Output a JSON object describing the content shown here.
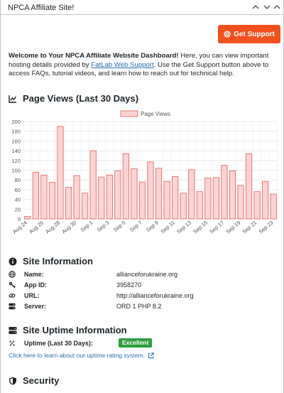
{
  "panel": {
    "title": "NPCA Affiliate Site!"
  },
  "support_button": {
    "label": "Get Support"
  },
  "intro": {
    "bold": "Welcome to Your NPCA Affiliate Website Dashboard!",
    "text1": " Here, you can view important hosting details provided by ",
    "link": "FatLab Web Support",
    "text2": ". Use the Get Support button above to access FAQs, tutorial videos, and learn how to reach out for technical help."
  },
  "page_views": {
    "heading": "Page Views (Last 30 Days)"
  },
  "chart_data": {
    "type": "bar",
    "x": [
      "Aug 24",
      "Aug 25",
      "Aug 26",
      "Aug 27",
      "Aug 28",
      "Aug 29",
      "Aug 30",
      "Aug 31",
      "Sep 1",
      "Sep 2",
      "Sep 3",
      "Sep 4",
      "Sep 5",
      "Sep 6",
      "Sep 7",
      "Sep 8",
      "Sep 9",
      "Sep 10",
      "Sep 11",
      "Sep 12",
      "Sep 13",
      "Sep 14",
      "Sep 15",
      "Sep 16",
      "Sep 17",
      "Sep 18",
      "Sep 19",
      "Sep 20",
      "Sep 21",
      "Sep 22",
      "Sep 23"
    ],
    "tick_labels": [
      "Aug 24",
      "Aug 26",
      "Aug 28",
      "Aug 30",
      "Sep 1",
      "Sep 3",
      "Sep 5",
      "Sep 7",
      "Sep 9",
      "Sep 11",
      "Sep 13",
      "Sep 15",
      "Sep 17",
      "Sep 19",
      "Sep 21",
      "Sep 23"
    ],
    "series": [
      {
        "name": "Page Views",
        "values": [
          5,
          96,
          90,
          75,
          190,
          65,
          89,
          53,
          140,
          86,
          90,
          99,
          134,
          103,
          76,
          117,
          104,
          77,
          87,
          53,
          101,
          56,
          84,
          85,
          110,
          99,
          69,
          134,
          56,
          77,
          51
        ]
      }
    ],
    "ylim": [
      0,
      200
    ],
    "yticks": [
      0,
      20,
      40,
      60,
      80,
      100,
      120,
      140,
      160,
      180,
      200
    ],
    "legend": "top",
    "grid": true,
    "colors": {
      "fill": "#fdd3d3",
      "stroke": "#e06060"
    }
  },
  "site_info": {
    "heading": "Site Information",
    "rows": [
      {
        "icon": "globe-icon",
        "label": "Name:",
        "value": "allianceforukraine.org"
      },
      {
        "icon": "key-icon",
        "label": "App ID:",
        "value": "3958270"
      },
      {
        "icon": "link-icon",
        "label": "URL:",
        "value": "http://allianceforukraine.org"
      },
      {
        "icon": "server-icon",
        "label": "Server:",
        "value": "ORD 1 PHP 8.2"
      }
    ]
  },
  "uptime": {
    "heading": "Site Uptime Information",
    "label": "Uptime (Last 30 Days):",
    "badge": "Excellent",
    "link": "Click here to learn about our uptime rating system."
  },
  "security": {
    "heading": "Security"
  },
  "colors": {
    "accent": "#f2501e",
    "link": "#2271b1",
    "badge": "#2e9e3a"
  }
}
